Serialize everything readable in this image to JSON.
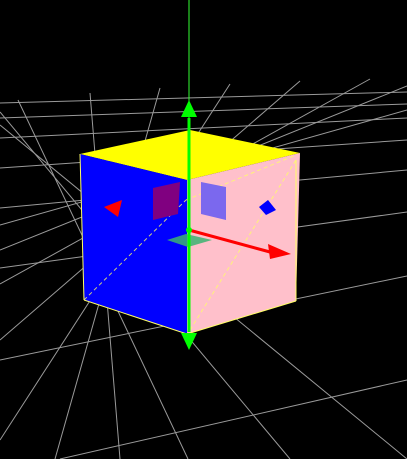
{
  "viewport": {
    "background_color": "#000000",
    "grid_color": "#9a9a9a"
  },
  "cube": {
    "faces": {
      "top": "#ffff00",
      "left": "#0000ff",
      "right": "#ffc0cb"
    },
    "edge_color": "#ffff66",
    "decals": [
      {
        "name": "left-face-cone",
        "color": "#ff0000"
      },
      {
        "name": "left-face-square",
        "color": "#800080"
      },
      {
        "name": "right-face-square",
        "color": "#7b68ee"
      },
      {
        "name": "right-face-cone",
        "color": "#0000ff"
      },
      {
        "name": "inner-plane",
        "color": "#3cb371"
      }
    ]
  },
  "gizmo": {
    "y_axis_color": "#00ff00",
    "x_axis_color": "#ff0000",
    "y_axis_line_color": "#33ff33"
  }
}
